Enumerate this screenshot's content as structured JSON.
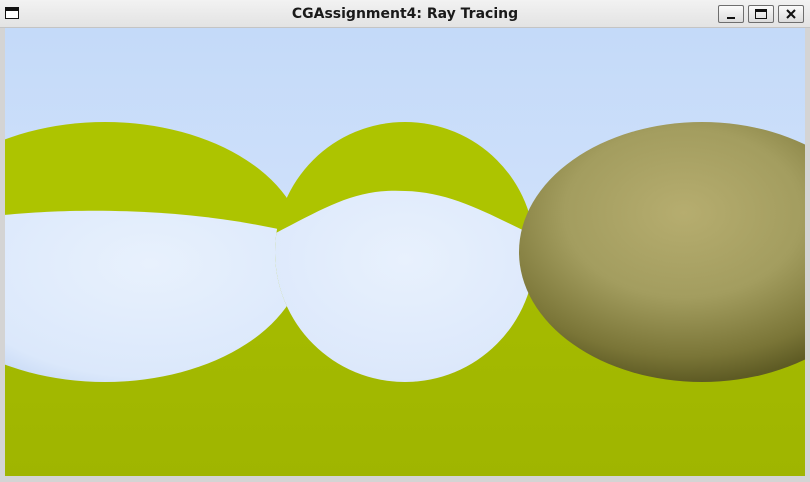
{
  "window": {
    "title": "CGAssignment4: Ray Tracing",
    "icons": {
      "system_menu": "window-icon",
      "minimize": "minimize-icon",
      "maximize": "maximize-icon",
      "close": "close-icon"
    }
  },
  "scene": {
    "description_colors": {
      "sky_top": "#c6dcfb",
      "sky_bottom": "#e2edfc",
      "ground": "#a9bf00",
      "left_sphere": "#acc300",
      "middle_sphere": "#acc300",
      "right_sphere": "#9c9858",
      "reflection": "#e4eefd"
    }
  }
}
